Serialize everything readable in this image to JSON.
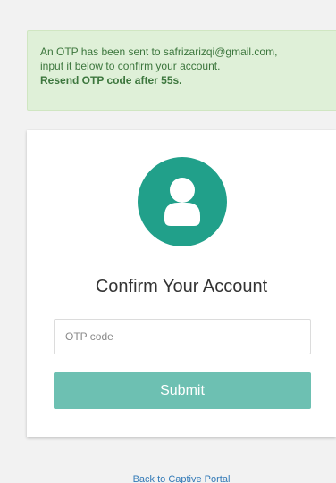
{
  "alert": {
    "line1": "An OTP has been sent to safrizarizqi@gmail.com,",
    "line2": "input it below to confirm your account.",
    "resend": "Resend OTP code after 55s."
  },
  "card": {
    "avatar_icon": "user-icon",
    "title": "Confirm Your Account",
    "otp_placeholder": "OTP code",
    "otp_value": "",
    "submit_label": "Submit"
  },
  "footer": {
    "back_link": "Back to Captive Portal"
  },
  "colors": {
    "page_bg": "#f2f2f2",
    "alert_bg": "#dff0d8",
    "alert_text": "#3c763d",
    "accent": "#21a08a",
    "button": "#6dc0b2",
    "link": "#337ab7"
  }
}
